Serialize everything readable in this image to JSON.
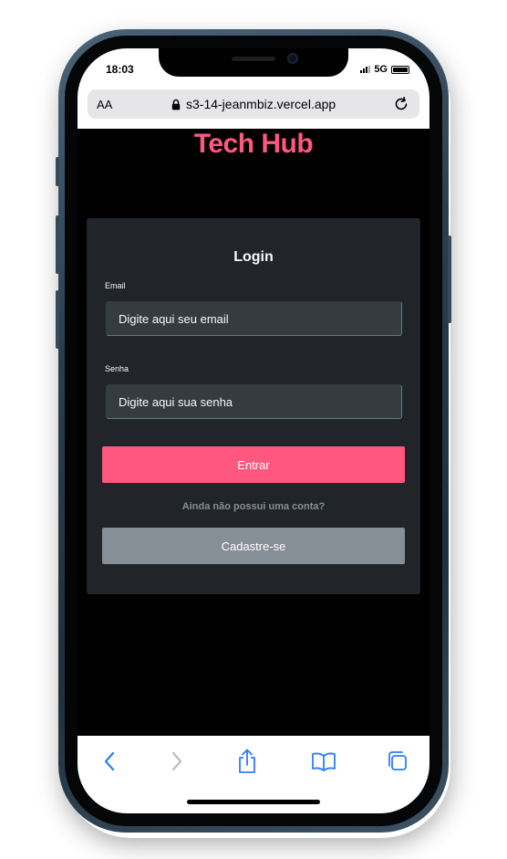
{
  "status_bar": {
    "time": "18:03",
    "network": "5G"
  },
  "browser": {
    "text_size_label": "AA",
    "url": "s3-14-jeanmbiz.vercel.app"
  },
  "page": {
    "logo": "Tech Hub",
    "login_form": {
      "title": "Login",
      "email_label": "Email",
      "email_placeholder": "Digite aqui seu email",
      "password_label": "Senha",
      "password_placeholder": "Digite aqui sua senha",
      "submit_label": "Entrar",
      "no_account_text": "Ainda não possui uma conta?",
      "register_label": "Cadastre-se"
    }
  },
  "toolbar_icons": [
    "back-icon",
    "forward-icon",
    "share-icon",
    "bookmarks-icon",
    "tabs-icon"
  ],
  "colors": {
    "brand": "#ff577f",
    "card_bg": "#212529",
    "input_bg": "#343b41",
    "secondary_button": "#868e96",
    "browser_accent": "#2f7cf6"
  }
}
